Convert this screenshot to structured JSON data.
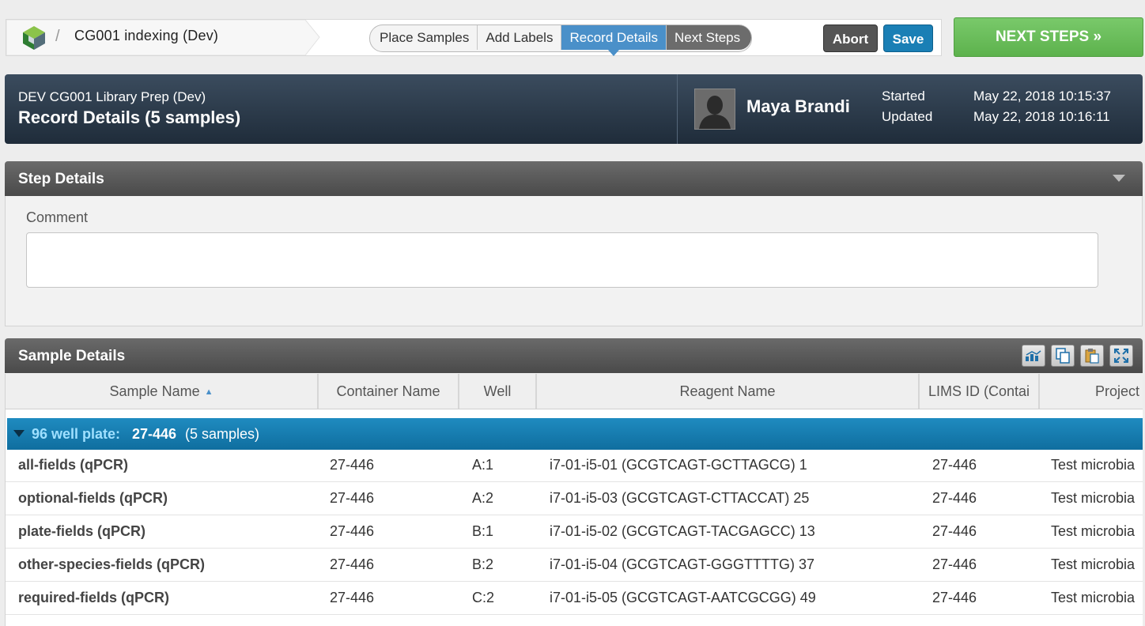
{
  "breadcrumb": {
    "title": "CG001 indexing (Dev)",
    "separator": "/"
  },
  "stepper": {
    "steps": [
      "Place Samples",
      "Add Labels",
      "Record Details",
      "Next Steps"
    ],
    "active": "Record Details"
  },
  "actions": {
    "abort": "Abort",
    "save": "Save",
    "next_steps": "NEXT STEPS »"
  },
  "header": {
    "subtitle": "DEV CG001 Library Prep (Dev)",
    "title": "Record Details (5 samples)",
    "user": "Maya Brandi",
    "started_label": "Started",
    "started_value": "May 22, 2018 10:15:37",
    "updated_label": "Updated",
    "updated_value": "May 22, 2018 10:16:11"
  },
  "step_details": {
    "title": "Step Details",
    "comment_label": "Comment",
    "comment_value": ""
  },
  "sample_details": {
    "title": "Sample Details",
    "columns": [
      "Sample Name",
      "Container Name",
      "Well",
      "Reagent Name",
      "LIMS ID (Contai",
      "Project"
    ],
    "group": {
      "label": "96 well plate:",
      "id": "27-446",
      "count": "(5 samples)"
    },
    "rows": [
      {
        "name": "all-fields (qPCR)",
        "container": "27-446",
        "well": "A:1",
        "reagent": "i7-01-i5-01 (GCGTCAGT-GCTTAGCG) 1",
        "lims": "27-446",
        "project": "Test microbia"
      },
      {
        "name": "optional-fields (qPCR)",
        "container": "27-446",
        "well": "A:2",
        "reagent": "i7-01-i5-03 (GCGTCAGT-CTTACCAT) 25",
        "lims": "27-446",
        "project": "Test microbia"
      },
      {
        "name": "plate-fields (qPCR)",
        "container": "27-446",
        "well": "B:1",
        "reagent": "i7-01-i5-02 (GCGTCAGT-TACGAGCC) 13",
        "lims": "27-446",
        "project": "Test microbia"
      },
      {
        "name": "other-species-fields (qPCR)",
        "container": "27-446",
        "well": "B:2",
        "reagent": "i7-01-i5-04 (GCGTCAGT-GGGTTTTG) 37",
        "lims": "27-446",
        "project": "Test microbia"
      },
      {
        "name": "required-fields (qPCR)",
        "container": "27-446",
        "well": "C:2",
        "reagent": "i7-01-i5-05 (GCGTCAGT-AATCGCGG) 49",
        "lims": "27-446",
        "project": "Test microbia"
      }
    ]
  },
  "colors": {
    "accent": "#4a90c9",
    "next_green": "#6abf5a",
    "header_dark": "#2a3847",
    "group_blue": "#1581b6"
  },
  "icons": [
    "logo-icon",
    "avatar-icon",
    "collapse-icon",
    "chart-icon",
    "copy-icon",
    "paste-icon",
    "expand-icon",
    "sort-asc-icon",
    "group-toggle-icon"
  ]
}
